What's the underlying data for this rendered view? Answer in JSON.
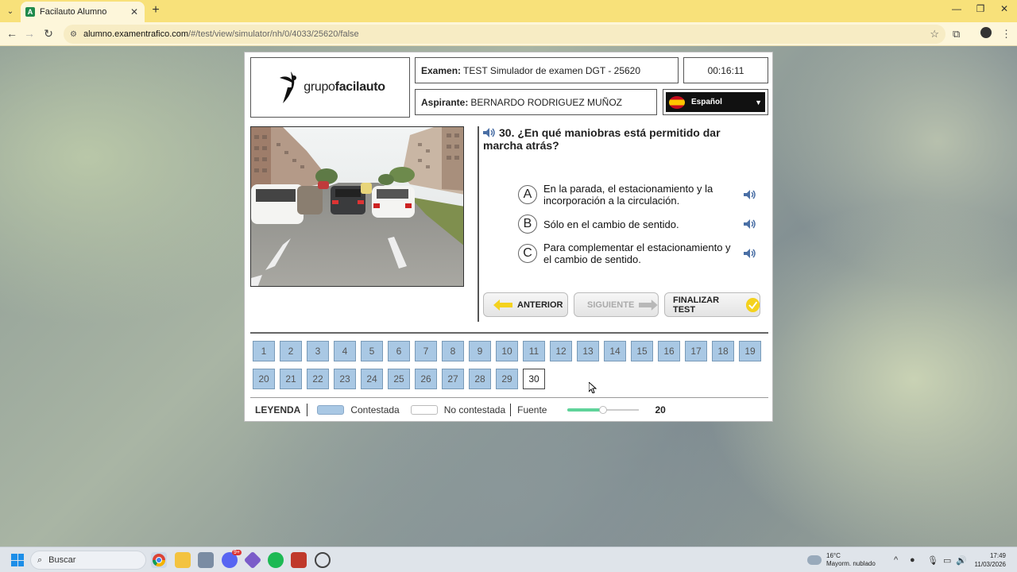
{
  "browser": {
    "tab_title": "Facilauto Alumno",
    "url_domain": "alumno.examentrafico.com",
    "url_path": "/#/test/view/simulator/nh/0/4033/25620/false"
  },
  "header": {
    "logo_text_regular": "grupo",
    "logo_text_bold": "facilauto",
    "exam_label": "Examen:",
    "exam_value": "TEST Simulador de examen DGT - 25620",
    "timer": "00:16:11",
    "aspirant_label": "Aspirante:",
    "aspirant_value": "BERNARDO RODRIGUEZ MUÑOZ",
    "language": "Español"
  },
  "question": {
    "number_text": "30.",
    "text": "¿En qué maniobras está permitido dar marcha atrás?"
  },
  "answers": [
    {
      "letter": "A",
      "text": "En la parada, el estacionamiento y la incorporación a la circulación."
    },
    {
      "letter": "B",
      "text": "Sólo en el cambio de sentido."
    },
    {
      "letter": "C",
      "text": "Para complementar el estacionamiento y el cambio de sentido."
    }
  ],
  "buttons": {
    "prev": "ANTERIOR",
    "next": "SIGUIENTE",
    "finish": "FINALIZAR TEST"
  },
  "question_numbers": [
    "1",
    "2",
    "3",
    "4",
    "5",
    "6",
    "7",
    "8",
    "9",
    "10",
    "11",
    "12",
    "13",
    "14",
    "15",
    "16",
    "17",
    "18",
    "19",
    "20",
    "21",
    "22",
    "23",
    "24",
    "25",
    "26",
    "27",
    "28",
    "29",
    "30"
  ],
  "current_question": "30",
  "legend": {
    "title": "LEYENDA",
    "answered": "Contestada",
    "unanswered": "No contestada",
    "font_label": "Fuente",
    "font_value": "20",
    "font_slider_fraction": 0.5
  },
  "taskbar": {
    "search_placeholder": "Buscar",
    "weather_temp": "16°C",
    "weather_desc": "Mayorm. nublado",
    "time": "17:49",
    "date": "11/03/2026",
    "discord_badge": "9+"
  },
  "colors": {
    "tabstrip": "#f8e17a",
    "answered": "#a9c8e4",
    "slider": "#5fd39a",
    "prev_arrow": "#f4d21e"
  }
}
